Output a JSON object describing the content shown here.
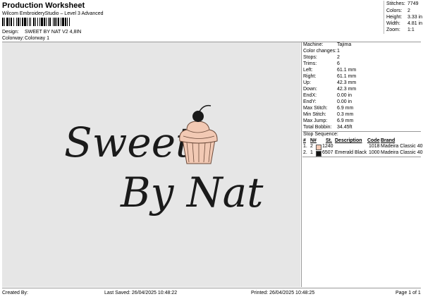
{
  "header": {
    "title": "Production Worksheet",
    "subtitle": "Wilcom EmbroideryStudio – Level 3 Advanced",
    "design_label": "Design:",
    "design_value": "SWEET BY NAT V2 4,8IN",
    "colorway_label": "Colorway:",
    "colorway_value": "Colorway 1"
  },
  "stats": [
    {
      "label": "Stitches:",
      "value": "7749"
    },
    {
      "label": "Colors:",
      "value": "2"
    },
    {
      "label": "Height:",
      "value": "3.33 in"
    },
    {
      "label": "Width:",
      "value": "4.81 in"
    },
    {
      "label": "Zoom:",
      "value": "1:1"
    }
  ],
  "details": [
    {
      "label": "Machine:",
      "value": "Tajima"
    },
    {
      "label": "Color changes:",
      "value": "1"
    },
    {
      "label": "Stops:",
      "value": "2"
    },
    {
      "label": "Trims:",
      "value": "6"
    },
    {
      "label": "Left:",
      "value": "61.1 mm"
    },
    {
      "label": "Right:",
      "value": "61.1 mm"
    },
    {
      "label": "Up:",
      "value": "42.3 mm"
    },
    {
      "label": "Down:",
      "value": "42.3 mm"
    },
    {
      "label": "EndX:",
      "value": "0.00 in"
    },
    {
      "label": "EndY:",
      "value": "0.00 in"
    },
    {
      "label": "Max Stitch:",
      "value": "6.9 mm"
    },
    {
      "label": "Min Stitch:",
      "value": "0.3 mm"
    },
    {
      "label": "Max Jump:",
      "value": "6.9 mm"
    },
    {
      "label": "Total Bobbin:",
      "value": "34.45ft"
    }
  ],
  "stop_sequence": {
    "title": "Stop Sequence:",
    "columns": [
      "#",
      "N#",
      "St.",
      "Description",
      "Code",
      "Brand"
    ],
    "rows": [
      {
        "index": "1.",
        "n": "2",
        "st": "1240",
        "description": "",
        "code": "1018",
        "brand": "Madeira Classic 40",
        "color": "#f2c9b4"
      },
      {
        "index": "2.",
        "n": "1",
        "st": "6507",
        "description": "Emerald Black",
        "code": "1000",
        "brand": "Madeira Classic 40",
        "color": "#111111"
      }
    ]
  },
  "design_preview": {
    "line1": "Sweets",
    "line2": "By Nat",
    "thread_dark": "#1a1a1a",
    "thread_light": "#f2c9b4",
    "background": "#e6e6e6"
  },
  "footer": {
    "created_by": "Created By:",
    "last_saved": "Last Saved: 26/04/2025 10:48:22",
    "printed": "Printed: 26/04/2025 10:48:25",
    "page": "Page 1 of 1"
  }
}
